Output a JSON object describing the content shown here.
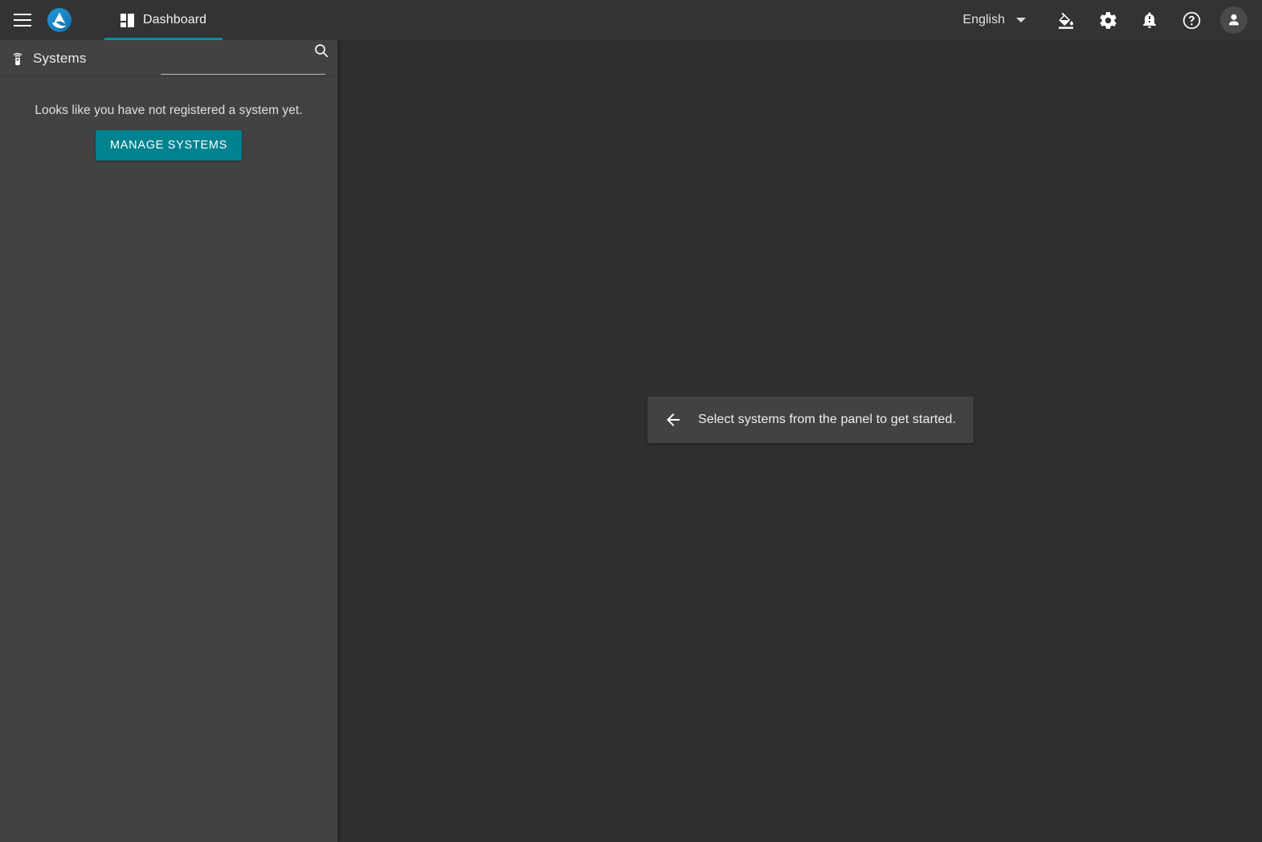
{
  "theme": {
    "topbar_bg": "#333333",
    "sidebar_bg": "#424242",
    "content_bg": "#303030",
    "accent": "#008f9e",
    "button_bg": "#00838f",
    "text": "#ececec"
  },
  "topbar": {
    "menu_label": "Menu",
    "brand_label": "Katello",
    "tabs": [
      {
        "label": "Dashboard",
        "icon": "dashboard-icon",
        "active": true
      }
    ],
    "language": {
      "label": "English",
      "icon": "chevron-down-icon"
    },
    "actions": [
      {
        "name": "theme-button",
        "icon": "format-color-fill-icon",
        "label": "Theme"
      },
      {
        "name": "settings-button",
        "icon": "gear-icon",
        "label": "Settings"
      },
      {
        "name": "notifications-button",
        "icon": "bell-alert-icon",
        "label": "Notifications"
      },
      {
        "name": "help-button",
        "icon": "help-circle-icon",
        "label": "Help"
      },
      {
        "name": "account-button",
        "icon": "person-icon",
        "label": "Account"
      }
    ]
  },
  "sidebar": {
    "title": "Systems",
    "title_icon": "settings-remote-icon",
    "search": {
      "value": "",
      "placeholder": "",
      "icon": "search-icon"
    },
    "empty_state": {
      "message": "Looks like you have not registered a system yet.",
      "button_label": "MANAGE SYSTEMS"
    }
  },
  "main": {
    "hint": {
      "icon": "arrow-left-icon",
      "text": "Select systems from the panel to get started."
    }
  }
}
